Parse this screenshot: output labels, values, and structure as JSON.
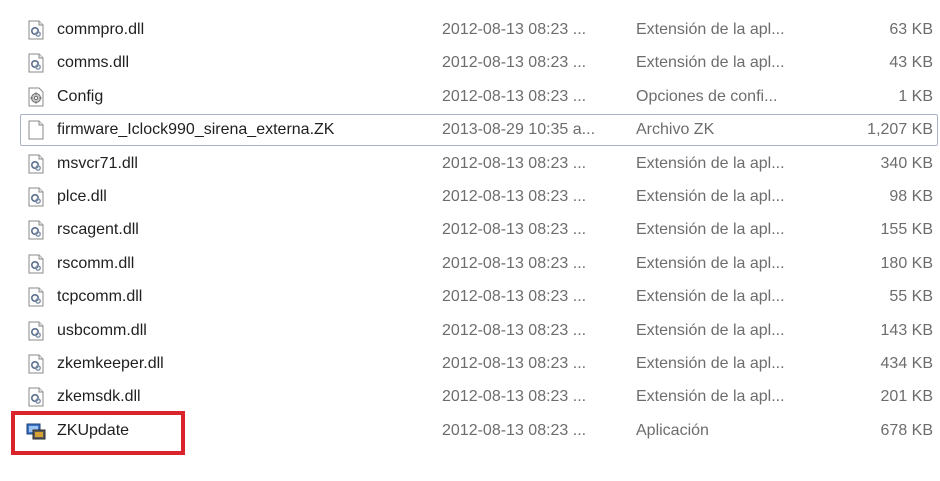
{
  "files": [
    {
      "name": "commpro.dll",
      "date": "2012-08-13 08:23 ...",
      "type": "Extensión de la apl...",
      "size": "63 KB",
      "icon": "dll-icon"
    },
    {
      "name": "comms.dll",
      "date": "2012-08-13 08:23 ...",
      "type": "Extensión de la apl...",
      "size": "43 KB",
      "icon": "dll-icon"
    },
    {
      "name": "Config",
      "date": "2012-08-13 08:23 ...",
      "type": "Opciones de confi...",
      "size": "1 KB",
      "icon": "config-icon"
    },
    {
      "name": "firmware_Iclock990_sirena_externa.ZK",
      "date": "2013-08-29 10:35 a...",
      "type": "Archivo ZK",
      "size": "1,207 KB",
      "icon": "blank-file-icon"
    },
    {
      "name": "msvcr71.dll",
      "date": "2012-08-13 08:23 ...",
      "type": "Extensión de la apl...",
      "size": "340 KB",
      "icon": "dll-icon"
    },
    {
      "name": "plce.dll",
      "date": "2012-08-13 08:23 ...",
      "type": "Extensión de la apl...",
      "size": "98 KB",
      "icon": "dll-icon"
    },
    {
      "name": "rscagent.dll",
      "date": "2012-08-13 08:23 ...",
      "type": "Extensión de la apl...",
      "size": "155 KB",
      "icon": "dll-icon"
    },
    {
      "name": "rscomm.dll",
      "date": "2012-08-13 08:23 ...",
      "type": "Extensión de la apl...",
      "size": "180 KB",
      "icon": "dll-icon"
    },
    {
      "name": "tcpcomm.dll",
      "date": "2012-08-13 08:23 ...",
      "type": "Extensión de la apl...",
      "size": "55 KB",
      "icon": "dll-icon"
    },
    {
      "name": "usbcomm.dll",
      "date": "2012-08-13 08:23 ...",
      "type": "Extensión de la apl...",
      "size": "143 KB",
      "icon": "dll-icon"
    },
    {
      "name": "zkemkeeper.dll",
      "date": "2012-08-13 08:23 ...",
      "type": "Extensión de la apl...",
      "size": "434 KB",
      "icon": "dll-icon"
    },
    {
      "name": "zkemsdk.dll",
      "date": "2012-08-13 08:23 ...",
      "type": "Extensión de la apl...",
      "size": "201 KB",
      "icon": "dll-icon"
    },
    {
      "name": "ZKUpdate",
      "date": "2012-08-13 08:23 ...",
      "type": "Aplicación",
      "size": "678 KB",
      "icon": "application-icon"
    }
  ],
  "selected_file": "firmware_Iclock990_sirena_externa.ZK",
  "highlighted_file": "ZKUpdate",
  "colors": {
    "highlight_border": "#d9242c",
    "selection_border": "#aab4c8",
    "name_text": "#1f1f1f",
    "detail_text": "#6d6d6d"
  }
}
